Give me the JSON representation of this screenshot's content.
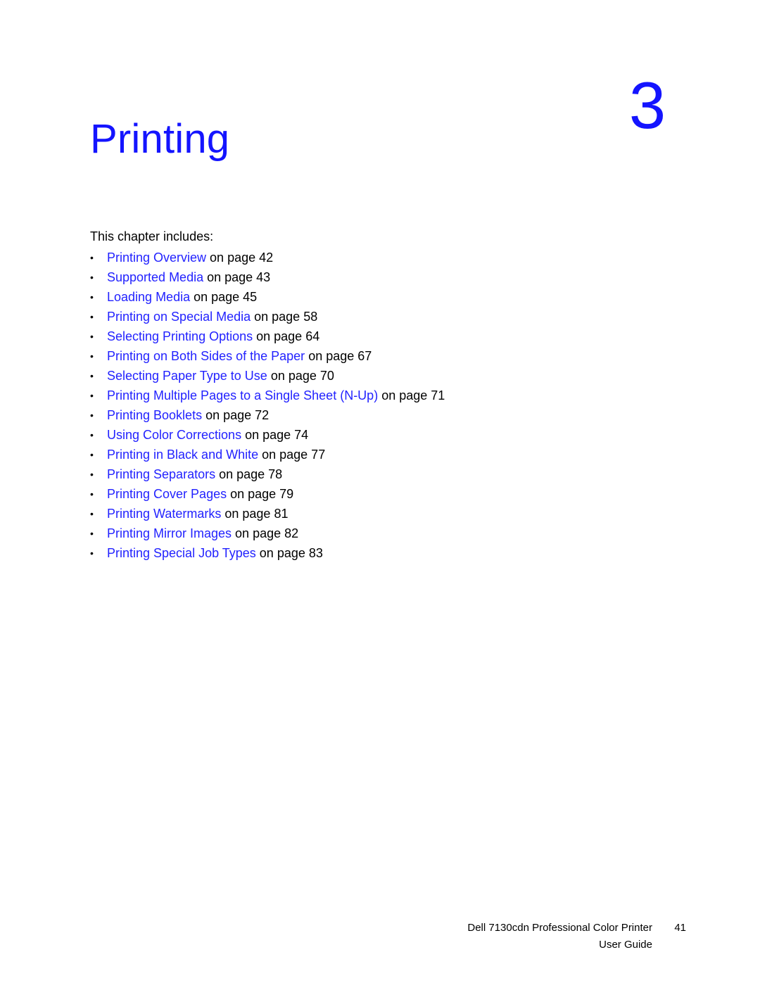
{
  "document": {
    "chapter": {
      "title": "Printing",
      "number": "3"
    },
    "intro": "This chapter includes:",
    "toc": {
      "bullet_glyph": "•",
      "items": [
        {
          "link": "Printing Overview",
          "tail": " on page 42"
        },
        {
          "link": "Supported Media",
          "tail": " on page 43"
        },
        {
          "link": "Loading Media",
          "tail": " on page 45"
        },
        {
          "link": "Printing on Special Media",
          "tail": " on page 58"
        },
        {
          "link": "Selecting Printing Options",
          "tail": " on page 64"
        },
        {
          "link": "Printing on Both Sides of the Paper",
          "tail": " on page 67"
        },
        {
          "link": "Selecting Paper Type to Use",
          "tail": " on page 70"
        },
        {
          "link": "Printing Multiple Pages to a Single Sheet (N-Up)",
          "tail": " on page 71"
        },
        {
          "link": "Printing Booklets",
          "tail": " on page 72"
        },
        {
          "link": "Using Color Corrections",
          "tail": " on page 74"
        },
        {
          "link": "Printing in Black and White",
          "tail": " on page 77"
        },
        {
          "link": "Printing Separators",
          "tail": " on page 78"
        },
        {
          "link": "Printing Cover Pages",
          "tail": " on page 79"
        },
        {
          "link": "Printing Watermarks",
          "tail": " on page 81"
        },
        {
          "link": "Printing Mirror Images",
          "tail": " on page 82"
        },
        {
          "link": "Printing Special Job Types",
          "tail": " on page 83"
        }
      ]
    },
    "footer": {
      "product": "Dell 7130cdn Professional Color Printer",
      "page_number": "41",
      "guide": "User Guide"
    },
    "colors": {
      "heading_blue": "#1414ff",
      "link_blue": "#2222ff",
      "body_black": "#000000",
      "page_background": "#ffffff"
    }
  }
}
